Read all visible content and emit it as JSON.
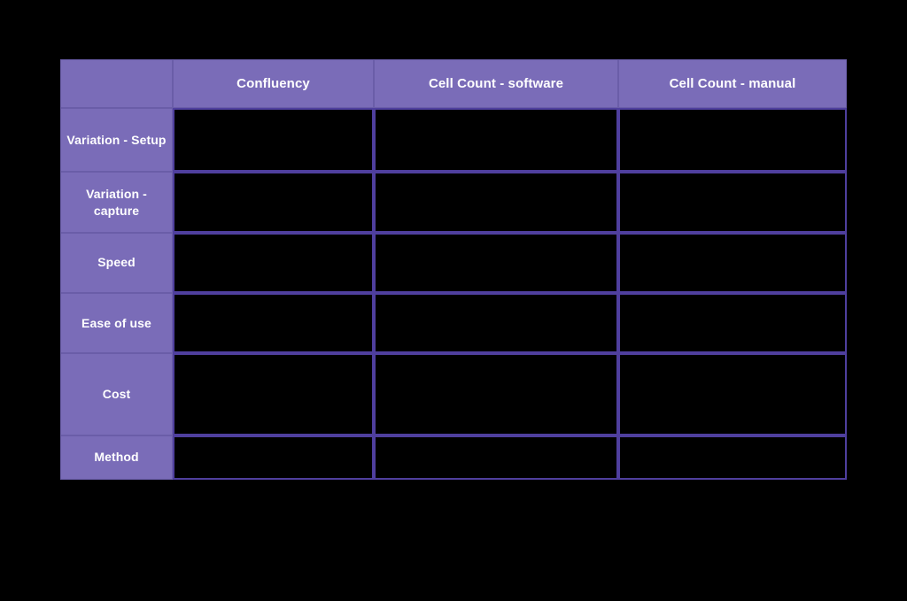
{
  "slide": {
    "background_color": "#000000",
    "accent_color": "#7a6cb8",
    "border_color": "#4f3f9e",
    "label_border_color": "#6a5da8",
    "text_color": "#ffffff"
  },
  "table": {
    "corner_label": "",
    "column_headers": [
      {
        "id": "confluency",
        "label": "Confluency"
      },
      {
        "id": "cell-count-software",
        "label": "Cell Count - software"
      },
      {
        "id": "cell-count-manual",
        "label": "Cell Count - manual"
      }
    ],
    "rows": [
      {
        "id": "variation-setup",
        "label": "Variation - Setup",
        "height_class": "row-h-72",
        "cells": [
          "",
          "",
          ""
        ]
      },
      {
        "id": "variation-capture",
        "label": "Variation - capture",
        "height_class": "row-h-68",
        "cells": [
          "",
          "",
          ""
        ]
      },
      {
        "id": "speed",
        "label": "Speed",
        "height_class": "row-h-68",
        "cells": [
          "",
          "",
          ""
        ]
      },
      {
        "id": "ease-of-use",
        "label": "Ease of use",
        "height_class": "row-h-68",
        "cells": [
          "",
          "",
          ""
        ]
      },
      {
        "id": "cost",
        "label": "Cost",
        "height_class": "row-h-92",
        "cells": [
          "",
          "",
          ""
        ]
      },
      {
        "id": "method",
        "label": "Method",
        "height_class": "row-h-50",
        "cells": [
          "",
          "",
          ""
        ]
      }
    ]
  }
}
